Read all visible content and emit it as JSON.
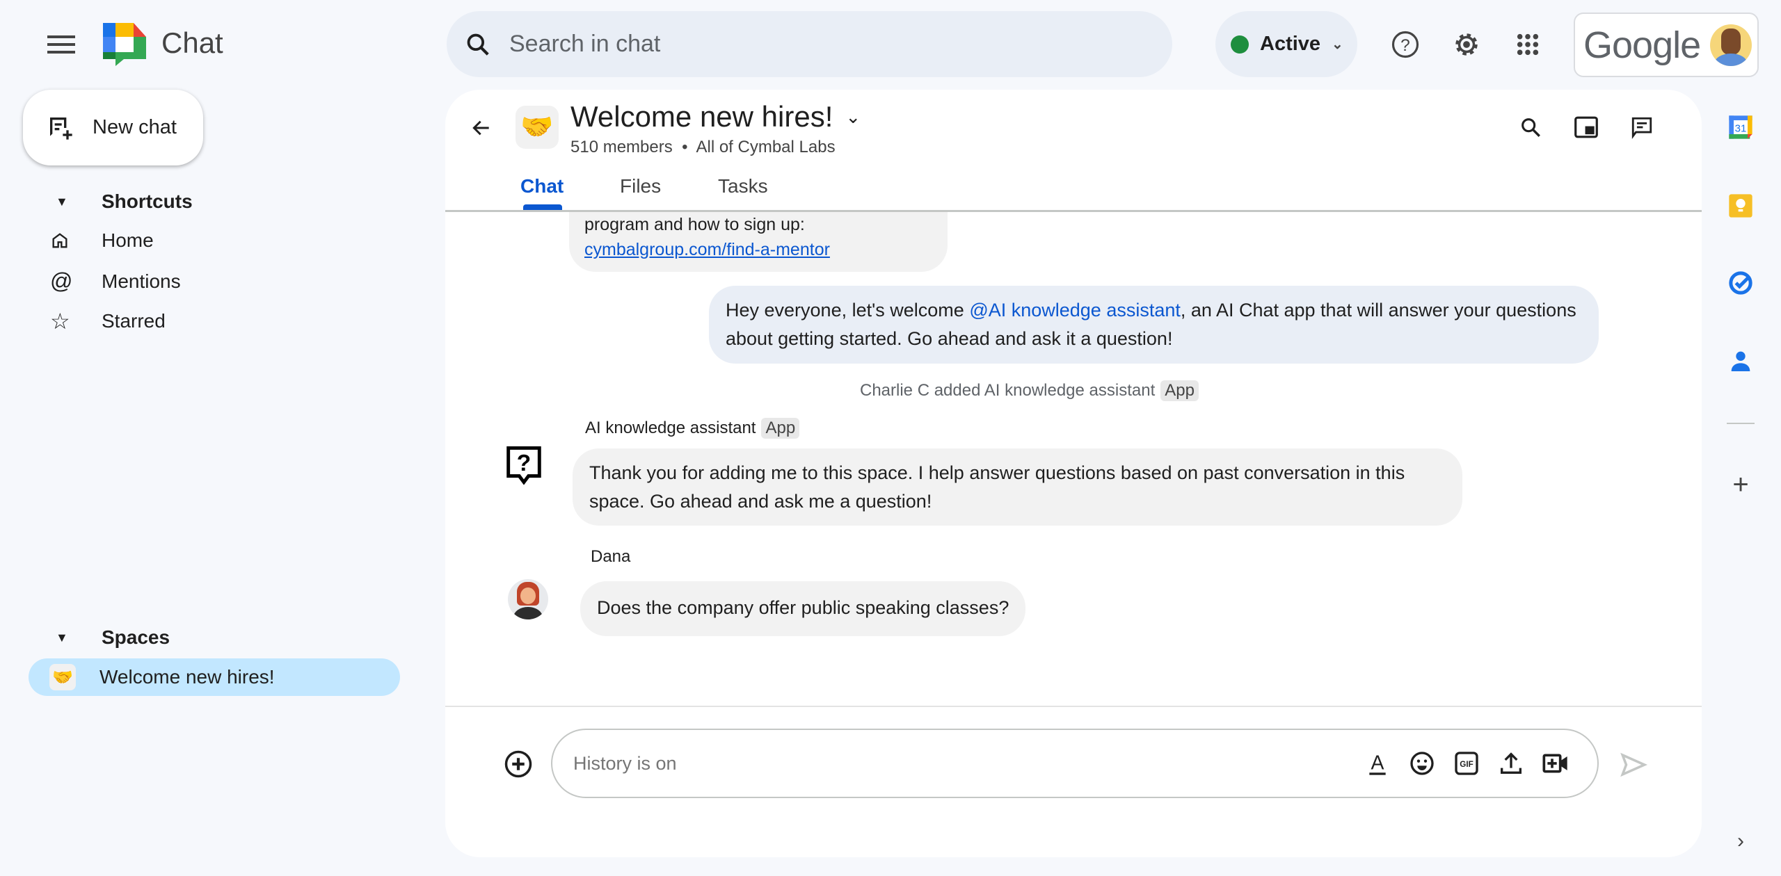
{
  "topbar": {
    "app_name": "Chat",
    "search_placeholder": "Search in chat",
    "status": "Active",
    "account_logo": "Google",
    "status_color": "#1e8e3e"
  },
  "sidebar": {
    "new_chat": "New chat",
    "shortcuts_header": "Shortcuts",
    "shortcuts": [
      {
        "label": "Home",
        "icon": "home-icon"
      },
      {
        "label": "Mentions",
        "icon": "at-icon"
      },
      {
        "label": "Starred",
        "icon": "star-icon"
      }
    ],
    "spaces_header": "Spaces",
    "spaces": [
      {
        "label": "Welcome new hires!",
        "icon": "handshake-icon",
        "selected": true
      }
    ]
  },
  "space": {
    "emoji": "🤝",
    "title": "Welcome new hires!",
    "members": "510 members",
    "org": "All of Cymbal Labs",
    "tabs": [
      "Chat",
      "Files",
      "Tasks"
    ],
    "active_tab": "Chat"
  },
  "messages": {
    "partial": {
      "text": "program and how to sign up:",
      "link": "cymbalgroup.com/find-a-mentor"
    },
    "outgoing": {
      "before": "Hey everyone, let's welcome ",
      "mention": "@AI knowledge assistant",
      "after": ", an AI Chat app that will answer your questions about getting started.  Go ahead and ask it a question!"
    },
    "system": {
      "text": "Charlie C added AI knowledge assistant",
      "badge": "App"
    },
    "ai": {
      "sender": "AI knowledge assistant",
      "badge": "App",
      "text": "Thank you for adding me to this space. I help answer questions based on past conversation in this space. Go ahead and ask me a question!"
    },
    "dana": {
      "sender": "Dana",
      "text": "Does the company offer public speaking classes?"
    }
  },
  "composer": {
    "placeholder": "History is on"
  },
  "colors": {
    "accent": "#0b57d0",
    "selected": "#c2e7ff",
    "bubble_out": "#e9eef6",
    "bubble_in": "#f2f2f2"
  }
}
